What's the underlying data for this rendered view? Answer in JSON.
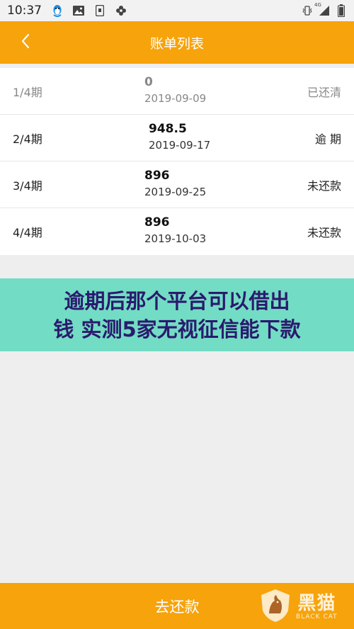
{
  "status_bar": {
    "time": "10:37",
    "network": "4G",
    "icons": [
      "qq-penguin-icon",
      "image-icon",
      "phone-icon",
      "flower-icon",
      "vibrate-icon",
      "signal-icon",
      "battery-icon"
    ]
  },
  "header": {
    "title": "账单列表",
    "back_icon": "chevron-left-icon"
  },
  "bills": [
    {
      "period": "1/4期",
      "amount": "0",
      "date": "2019-09-09",
      "status": "已还清"
    },
    {
      "period": "2/4期",
      "amount": "948.5",
      "date": "2019-09-17",
      "status": "逾 期"
    },
    {
      "period": "3/4期",
      "amount": "896",
      "date": "2019-09-25",
      "status": "未还款"
    },
    {
      "period": "4/4期",
      "amount": "896",
      "date": "2019-10-03",
      "status": "未还款"
    }
  ],
  "overlay": {
    "line1": "逾期后那个平台可以借出",
    "line2": "钱 实测5家无视征信能下款"
  },
  "footer": {
    "repay_label": "去还款"
  },
  "watermark": {
    "text_cn": "黑猫",
    "text_en": "BLACK CAT"
  },
  "colors": {
    "accent": "#f7a30b",
    "banner": "#73dcc4",
    "banner_text": "#2a1a6e"
  }
}
